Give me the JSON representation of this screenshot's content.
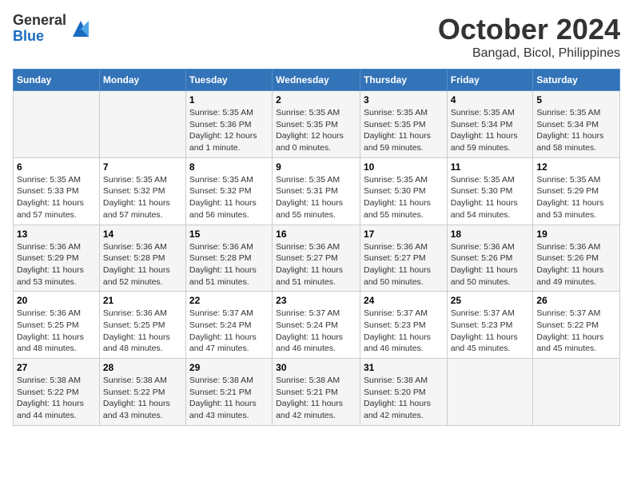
{
  "logo": {
    "general": "General",
    "blue": "Blue"
  },
  "title": "October 2024",
  "subtitle": "Bangad, Bicol, Philippines",
  "days_header": [
    "Sunday",
    "Monday",
    "Tuesday",
    "Wednesday",
    "Thursday",
    "Friday",
    "Saturday"
  ],
  "weeks": [
    [
      {
        "day": "",
        "sunrise": "",
        "sunset": "",
        "daylight": ""
      },
      {
        "day": "",
        "sunrise": "",
        "sunset": "",
        "daylight": ""
      },
      {
        "day": "1",
        "sunrise": "Sunrise: 5:35 AM",
        "sunset": "Sunset: 5:36 PM",
        "daylight": "Daylight: 12 hours and 1 minute."
      },
      {
        "day": "2",
        "sunrise": "Sunrise: 5:35 AM",
        "sunset": "Sunset: 5:35 PM",
        "daylight": "Daylight: 12 hours and 0 minutes."
      },
      {
        "day": "3",
        "sunrise": "Sunrise: 5:35 AM",
        "sunset": "Sunset: 5:35 PM",
        "daylight": "Daylight: 11 hours and 59 minutes."
      },
      {
        "day": "4",
        "sunrise": "Sunrise: 5:35 AM",
        "sunset": "Sunset: 5:34 PM",
        "daylight": "Daylight: 11 hours and 59 minutes."
      },
      {
        "day": "5",
        "sunrise": "Sunrise: 5:35 AM",
        "sunset": "Sunset: 5:34 PM",
        "daylight": "Daylight: 11 hours and 58 minutes."
      }
    ],
    [
      {
        "day": "6",
        "sunrise": "Sunrise: 5:35 AM",
        "sunset": "Sunset: 5:33 PM",
        "daylight": "Daylight: 11 hours and 57 minutes."
      },
      {
        "day": "7",
        "sunrise": "Sunrise: 5:35 AM",
        "sunset": "Sunset: 5:32 PM",
        "daylight": "Daylight: 11 hours and 57 minutes."
      },
      {
        "day": "8",
        "sunrise": "Sunrise: 5:35 AM",
        "sunset": "Sunset: 5:32 PM",
        "daylight": "Daylight: 11 hours and 56 minutes."
      },
      {
        "day": "9",
        "sunrise": "Sunrise: 5:35 AM",
        "sunset": "Sunset: 5:31 PM",
        "daylight": "Daylight: 11 hours and 55 minutes."
      },
      {
        "day": "10",
        "sunrise": "Sunrise: 5:35 AM",
        "sunset": "Sunset: 5:30 PM",
        "daylight": "Daylight: 11 hours and 55 minutes."
      },
      {
        "day": "11",
        "sunrise": "Sunrise: 5:35 AM",
        "sunset": "Sunset: 5:30 PM",
        "daylight": "Daylight: 11 hours and 54 minutes."
      },
      {
        "day": "12",
        "sunrise": "Sunrise: 5:35 AM",
        "sunset": "Sunset: 5:29 PM",
        "daylight": "Daylight: 11 hours and 53 minutes."
      }
    ],
    [
      {
        "day": "13",
        "sunrise": "Sunrise: 5:36 AM",
        "sunset": "Sunset: 5:29 PM",
        "daylight": "Daylight: 11 hours and 53 minutes."
      },
      {
        "day": "14",
        "sunrise": "Sunrise: 5:36 AM",
        "sunset": "Sunset: 5:28 PM",
        "daylight": "Daylight: 11 hours and 52 minutes."
      },
      {
        "day": "15",
        "sunrise": "Sunrise: 5:36 AM",
        "sunset": "Sunset: 5:28 PM",
        "daylight": "Daylight: 11 hours and 51 minutes."
      },
      {
        "day": "16",
        "sunrise": "Sunrise: 5:36 AM",
        "sunset": "Sunset: 5:27 PM",
        "daylight": "Daylight: 11 hours and 51 minutes."
      },
      {
        "day": "17",
        "sunrise": "Sunrise: 5:36 AM",
        "sunset": "Sunset: 5:27 PM",
        "daylight": "Daylight: 11 hours and 50 minutes."
      },
      {
        "day": "18",
        "sunrise": "Sunrise: 5:36 AM",
        "sunset": "Sunset: 5:26 PM",
        "daylight": "Daylight: 11 hours and 50 minutes."
      },
      {
        "day": "19",
        "sunrise": "Sunrise: 5:36 AM",
        "sunset": "Sunset: 5:26 PM",
        "daylight": "Daylight: 11 hours and 49 minutes."
      }
    ],
    [
      {
        "day": "20",
        "sunrise": "Sunrise: 5:36 AM",
        "sunset": "Sunset: 5:25 PM",
        "daylight": "Daylight: 11 hours and 48 minutes."
      },
      {
        "day": "21",
        "sunrise": "Sunrise: 5:36 AM",
        "sunset": "Sunset: 5:25 PM",
        "daylight": "Daylight: 11 hours and 48 minutes."
      },
      {
        "day": "22",
        "sunrise": "Sunrise: 5:37 AM",
        "sunset": "Sunset: 5:24 PM",
        "daylight": "Daylight: 11 hours and 47 minutes."
      },
      {
        "day": "23",
        "sunrise": "Sunrise: 5:37 AM",
        "sunset": "Sunset: 5:24 PM",
        "daylight": "Daylight: 11 hours and 46 minutes."
      },
      {
        "day": "24",
        "sunrise": "Sunrise: 5:37 AM",
        "sunset": "Sunset: 5:23 PM",
        "daylight": "Daylight: 11 hours and 46 minutes."
      },
      {
        "day": "25",
        "sunrise": "Sunrise: 5:37 AM",
        "sunset": "Sunset: 5:23 PM",
        "daylight": "Daylight: 11 hours and 45 minutes."
      },
      {
        "day": "26",
        "sunrise": "Sunrise: 5:37 AM",
        "sunset": "Sunset: 5:22 PM",
        "daylight": "Daylight: 11 hours and 45 minutes."
      }
    ],
    [
      {
        "day": "27",
        "sunrise": "Sunrise: 5:38 AM",
        "sunset": "Sunset: 5:22 PM",
        "daylight": "Daylight: 11 hours and 44 minutes."
      },
      {
        "day": "28",
        "sunrise": "Sunrise: 5:38 AM",
        "sunset": "Sunset: 5:22 PM",
        "daylight": "Daylight: 11 hours and 43 minutes."
      },
      {
        "day": "29",
        "sunrise": "Sunrise: 5:38 AM",
        "sunset": "Sunset: 5:21 PM",
        "daylight": "Daylight: 11 hours and 43 minutes."
      },
      {
        "day": "30",
        "sunrise": "Sunrise: 5:38 AM",
        "sunset": "Sunset: 5:21 PM",
        "daylight": "Daylight: 11 hours and 42 minutes."
      },
      {
        "day": "31",
        "sunrise": "Sunrise: 5:38 AM",
        "sunset": "Sunset: 5:20 PM",
        "daylight": "Daylight: 11 hours and 42 minutes."
      },
      {
        "day": "",
        "sunrise": "",
        "sunset": "",
        "daylight": ""
      },
      {
        "day": "",
        "sunrise": "",
        "sunset": "",
        "daylight": ""
      }
    ]
  ]
}
